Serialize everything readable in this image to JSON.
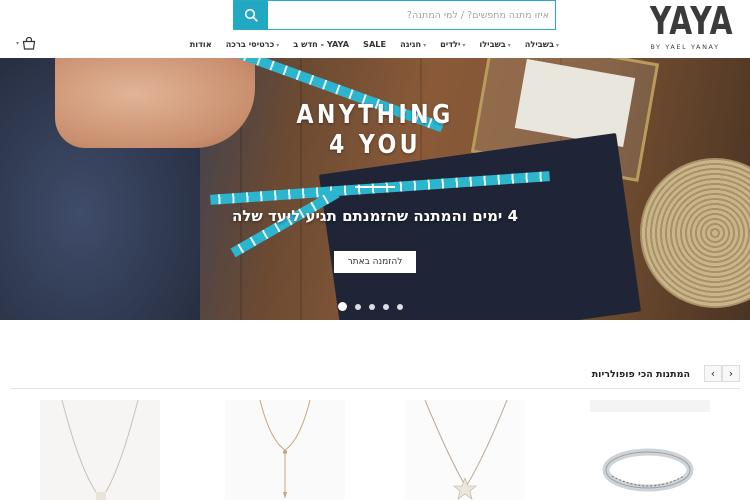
{
  "brand": {
    "logo": "YAYA",
    "logo_sub": "BY YAEL YANAY"
  },
  "search": {
    "placeholder": "איזו מתנה מחפשים? / למי המתנה?"
  },
  "nav": {
    "items": [
      {
        "label": "בשבילה",
        "has_dropdown": true
      },
      {
        "label": "בשבילו",
        "has_dropdown": true
      },
      {
        "label": "ילדים",
        "has_dropdown": true
      },
      {
        "label": "חגיגה",
        "has_dropdown": true
      },
      {
        "label": "SALE",
        "has_dropdown": false
      },
      {
        "label": "חדש ב - YAYA",
        "has_dropdown": false
      },
      {
        "label": "כרטיסי ברכה",
        "has_dropdown": true
      },
      {
        "label": "אודות",
        "has_dropdown": false
      }
    ]
  },
  "hero": {
    "title_line1": "ANYTHING",
    "title_line2": "4 YOU",
    "subtitle": "4 ימים והמתנה שהזמנתם תגיע ליעד שלה",
    "cta": "להזמנה באתר",
    "slide_count": 5,
    "active_slide": 1
  },
  "popular": {
    "title": "המתנות הכי פופולריות",
    "prev_arrow": "‹",
    "next_arrow": "›"
  },
  "colors": {
    "accent": "#20a9c0",
    "text": "#222222"
  },
  "icons": {
    "search": "search-icon",
    "cart": "shopping-bag-icon",
    "dropdown": "chevron-down-icon"
  }
}
